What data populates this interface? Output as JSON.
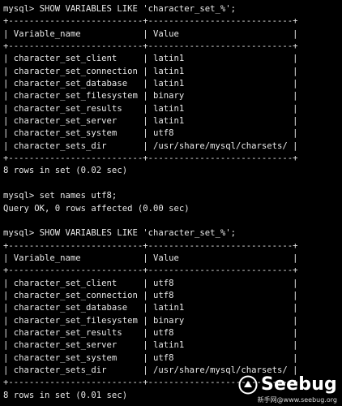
{
  "terminal": {
    "lines": [
      "mysql> SHOW VARIABLES LIKE 'character_set_%';",
      "+--------------------------+----------------------------+",
      "| Variable_name            | Value                      |",
      "+--------------------------+----------------------------+",
      "| character_set_client     | latin1                     |",
      "| character_set_connection | latin1                     |",
      "| character_set_database   | latin1                     |",
      "| character_set_filesystem | binary                     |",
      "| character_set_results    | latin1                     |",
      "| character_set_server     | latin1                     |",
      "| character_set_system     | utf8                       |",
      "| character_sets_dir       | /usr/share/mysql/charsets/ |",
      "+--------------------------+----------------------------+",
      "8 rows in set (0.02 sec)",
      "",
      "mysql> set names utf8;",
      "Query OK, 0 rows affected (0.00 sec)",
      "",
      "mysql> SHOW VARIABLES LIKE 'character_set_%';",
      "+--------------------------+----------------------------+",
      "| Variable_name            | Value                      |",
      "+--------------------------+----------------------------+",
      "| character_set_client     | utf8                       |",
      "| character_set_connection | utf8                       |",
      "| character_set_database   | latin1                     |",
      "| character_set_filesystem | binary                     |",
      "| character_set_results    | utf8                       |",
      "| character_set_server     | latin1                     |",
      "| character_set_system     | utf8                       |",
      "| character_sets_dir       | /usr/share/mysql/charsets/ |",
      "+--------------------------+----------------------------+",
      "8 rows in set (0.01 sec)"
    ]
  },
  "watermark": {
    "brand": "Seebug",
    "site": "新手网@www.seebug.org",
    "icon": "seebug-logo-icon"
  },
  "colors": {
    "background": "#000000",
    "text": "#e8e8e8"
  }
}
